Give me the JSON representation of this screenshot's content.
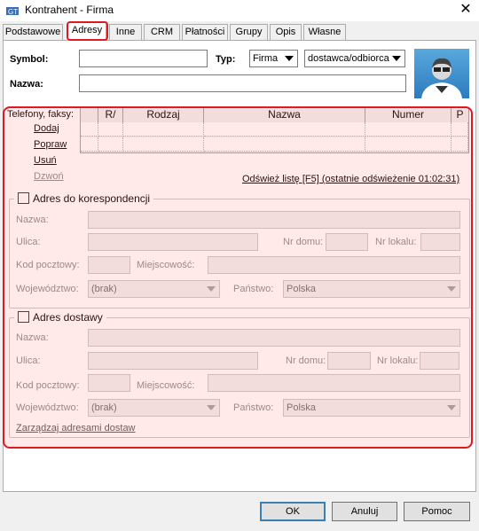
{
  "window": {
    "title": "Kontrahent - Firma"
  },
  "tabs": [
    {
      "label": "Podstawowe"
    },
    {
      "label": "Adresy"
    },
    {
      "label": "Inne"
    },
    {
      "label": "CRM"
    },
    {
      "label": "Płatności"
    },
    {
      "label": "Grupy"
    },
    {
      "label": "Opis"
    },
    {
      "label": "Własne"
    }
  ],
  "form": {
    "symbol_label": "Symbol:",
    "symbol_value": "",
    "typ_label": "Typ:",
    "typ_value": "Firma",
    "typ2_value": "dostawca/odbiorca",
    "nazwa_label": "Nazwa:",
    "nazwa_value": ""
  },
  "phones": {
    "label": "Telefony, faksy:",
    "columns": [
      "R/",
      "Rodzaj",
      "Nazwa",
      "Numer",
      "P"
    ],
    "actions": [
      "Dodaj",
      "Popraw",
      "Usuń",
      "Dzwoń"
    ],
    "refresh": "Odśwież listę [F5] (ostatnie odświeżenie 01:02:31)"
  },
  "korespondencja": {
    "title": "Adres do korespondencji",
    "nazwa": "Nazwa:",
    "ulica": "Ulica:",
    "nr_domu": "Nr domu:",
    "nr_lokalu": "Nr lokalu:",
    "kod": "Kod pocztowy:",
    "miejscowosc": "Miejscowość:",
    "wojewodztwo": "Województwo:",
    "wojewodztwo_value": "(brak)",
    "panstwo": "Państwo:",
    "panstwo_value": "Polska"
  },
  "dostawa": {
    "title": "Adres dostawy",
    "nazwa": "Nazwa:",
    "ulica": "Ulica:",
    "nr_domu": "Nr domu:",
    "nr_lokalu": "Nr lokalu:",
    "kod": "Kod pocztowy:",
    "miejscowosc": "Miejscowość:",
    "wojewodztwo": "Województwo:",
    "wojewodztwo_value": "(brak)",
    "panstwo": "Państwo:",
    "panstwo_value": "Polska",
    "manage": "Zarządzaj adresami dostaw"
  },
  "buttons": {
    "ok": "OK",
    "anuluj": "Anuluj",
    "pomoc": "Pomoc"
  },
  "colors": {
    "highlight": "#e0181f",
    "focus_border": "#3c7fb1"
  },
  "icons": {
    "avatar": "user-avatar-icon",
    "close": "close-icon",
    "app": "app-icon"
  }
}
